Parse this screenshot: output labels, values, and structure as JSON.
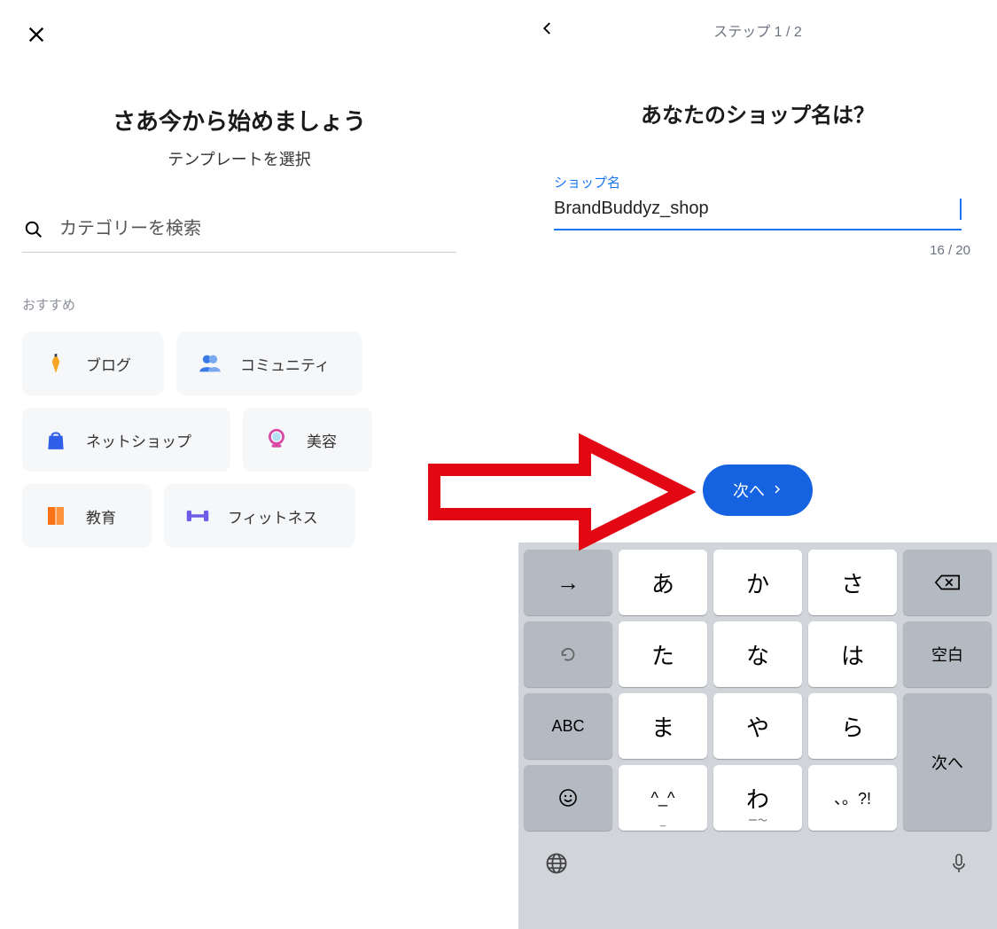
{
  "left": {
    "title": "さあ今から始めましょう",
    "subtitle": "テンプレートを選択",
    "search_placeholder": "カテゴリーを検索",
    "section_label": "おすすめ",
    "categories": [
      {
        "label": "ブログ",
        "icon": "pen"
      },
      {
        "label": "コミュニティ",
        "icon": "people"
      },
      {
        "label": "ネットショップ",
        "icon": "bag"
      },
      {
        "label": "美容",
        "icon": "mirror"
      },
      {
        "label": "教育",
        "icon": "book"
      },
      {
        "label": "フィットネス",
        "icon": "dumbbell"
      }
    ]
  },
  "right": {
    "step_text": "ステップ 1 / 2",
    "title": "あなたのショップ名は？",
    "field_label": "ショップ名",
    "field_value": "BrandBuddyz_shop",
    "char_count": "16 / 20",
    "next_label": "次へ"
  },
  "keyboard": {
    "rows": [
      [
        "→",
        "あ",
        "か",
        "さ",
        "⌫"
      ],
      [
        "↺",
        "た",
        "な",
        "は",
        "空白"
      ],
      [
        "ABC",
        "ま",
        "や",
        "ら",
        "次へ"
      ],
      [
        "☺",
        "^_^",
        "わ",
        "、。?!",
        ""
      ]
    ],
    "subs": {
      "^_^": "_",
      "わ": "ー～"
    }
  }
}
